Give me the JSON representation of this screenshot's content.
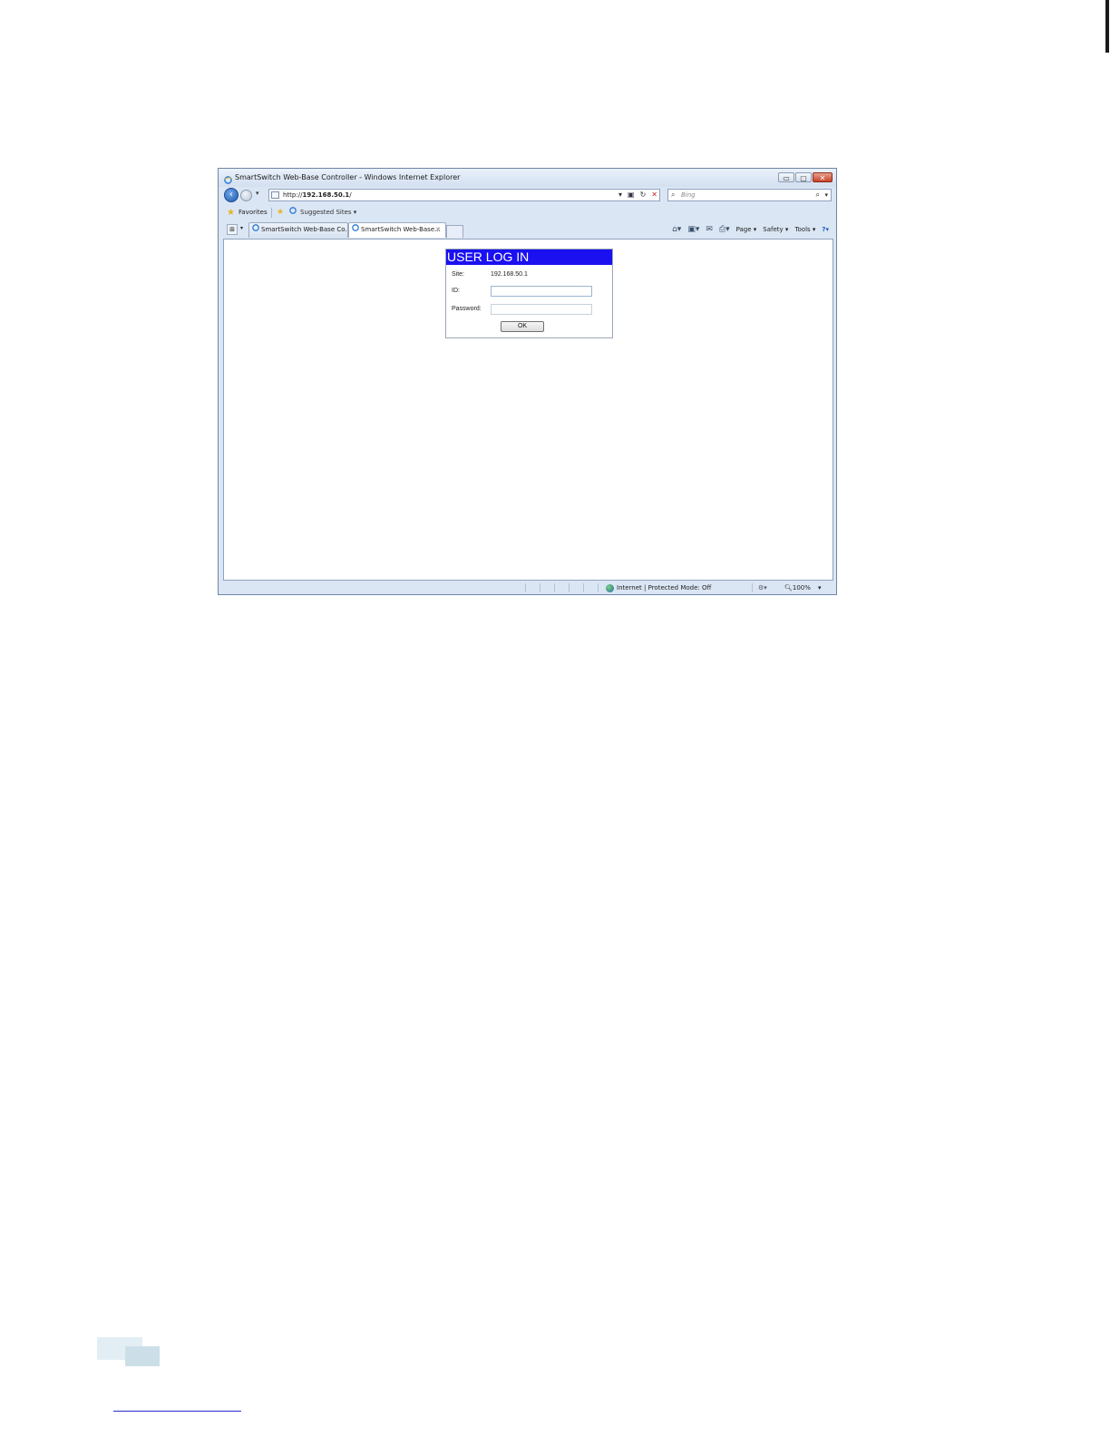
{
  "window": {
    "title": "SmartSwitch Web-Base Controller - Windows Internet Explorer",
    "buttons": {
      "minimize": "▭",
      "maximize": "▢",
      "close": "✕"
    }
  },
  "addressbar": {
    "url_prefix": "http://",
    "url_host": "192.168.50.1",
    "url_suffix": "/"
  },
  "search": {
    "placeholder": "Bing"
  },
  "favorites": {
    "label": "Favorites",
    "suggested": "Suggested Sites ▾"
  },
  "tabs": [
    {
      "label": "SmartSwitch Web-Base Co..."
    },
    {
      "label": "SmartSwitch Web-Base..."
    }
  ],
  "commandbar": {
    "page": "Page ▾",
    "safety": "Safety ▾",
    "tools": "Tools ▾",
    "help": "?▾"
  },
  "login": {
    "title": "USER LOG IN",
    "site_label": "Site:",
    "site_value": "192.168.50.1",
    "id_label": "ID:",
    "password_label": "Password:",
    "ok_label": "OK"
  },
  "statusbar": {
    "zone": "Internet | Protected Mode: Off",
    "zoom": "100%"
  },
  "icons": {
    "back": "back-arrow-icon",
    "forward": "forward-arrow-icon",
    "search": "magnifier-icon",
    "globe": "globe-icon",
    "star": "star-icon"
  }
}
